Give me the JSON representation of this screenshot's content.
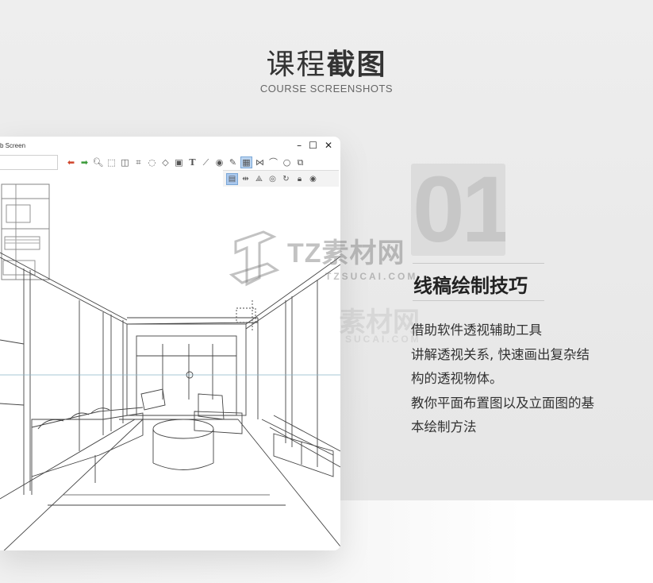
{
  "header": {
    "title_light": "课程",
    "title_bold": "截图",
    "subtitle": "COURSE SCREENSHOTS"
  },
  "window": {
    "title": "b Screen",
    "controls": {
      "minimize": "–",
      "maximize": "☐",
      "close": "✕"
    },
    "toolbar_icons": [
      "undo-icon",
      "redo-icon",
      "zoom-icon",
      "select-rect-icon",
      "select-alt-icon",
      "crop-icon",
      "lasso-icon",
      "transform-icon",
      "smudge-icon",
      "text-icon",
      "ruler-icon",
      "brush-icon",
      "pen-icon",
      "perspective-grid-icon",
      "symmetry-icon",
      "curve-icon",
      "ellipse-icon",
      "layers-icon"
    ],
    "toolbar2_icons": [
      "grid-2d-icon",
      "vanishing-h-icon",
      "vanishing-v-icon",
      "target-icon",
      "rotate-icon",
      "lock-icon",
      "eye-icon"
    ]
  },
  "section": {
    "number": "01",
    "title": "线稿绘制技巧",
    "description_lines": [
      "借助软件透视辅助工具",
      "讲解透视关系, 快速画出复杂结",
      "构的透视物体。",
      "教你平面布置图以及立面图的基",
      "本绘制方法"
    ]
  },
  "watermark": {
    "brand": "TZ素材网",
    "domain": "TZSUCAI.COM",
    "brand_faint": "素材网",
    "domain_faint": "SUCAI.COM"
  },
  "colors": {
    "panel": "#e9e9e9",
    "text_dark": "#333333",
    "accent_blue": "#bcd6f2"
  }
}
